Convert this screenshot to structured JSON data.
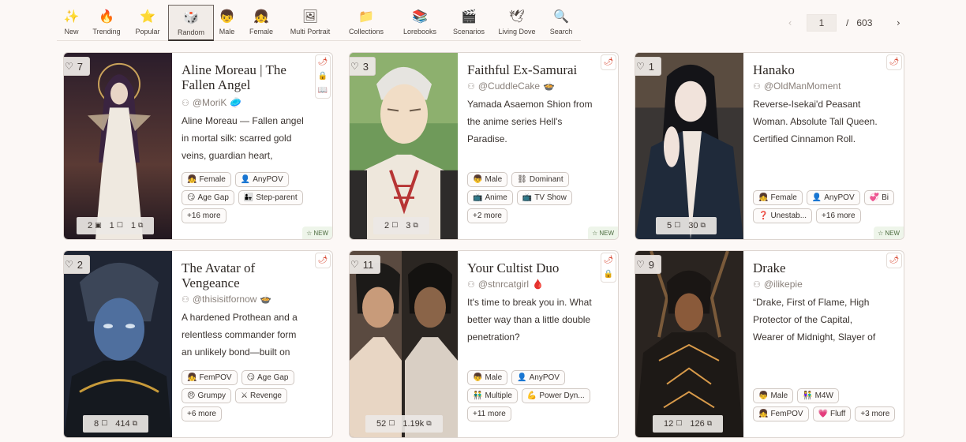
{
  "nav": {
    "items": [
      {
        "label": "New",
        "icon": "✨"
      },
      {
        "label": "Trending",
        "icon": "🔥"
      },
      {
        "label": "Popular",
        "icon": "⭐"
      },
      {
        "label": "Random",
        "icon": "🎲"
      },
      {
        "label": "Male",
        "icon": "👦"
      },
      {
        "label": "Female",
        "icon": "👧"
      },
      {
        "label": "Multi Portrait",
        "icon": "🖼"
      },
      {
        "label": "Collections",
        "icon": "📁"
      },
      {
        "label": "Lorebooks",
        "icon": "📚"
      },
      {
        "label": "Scenarios",
        "icon": "🎬"
      },
      {
        "label": "Living Dove",
        "icon": "🕊"
      },
      {
        "label": "Search",
        "icon": "🔍"
      }
    ],
    "active": "Random"
  },
  "pager": {
    "current": "1",
    "separator": "/",
    "total": "603",
    "prev": "‹",
    "next": "›"
  },
  "cards": [
    {
      "likes": "7",
      "title": "Aline Moreau | The Fallen Angel Adoptive...",
      "author": "@MoriK",
      "author_badge": "🥏",
      "desc": "Aline Moreau — Fallen angel in mortal silk: scarred gold veins, guardian heart, apocalypse-...",
      "tags": [
        {
          "icon": "👧",
          "label": "Female"
        },
        {
          "icon": "👤",
          "label": "AnyPOV"
        },
        {
          "icon": "😏",
          "label": "Age Gap"
        },
        {
          "icon": "👨‍👧",
          "label": "Step-parent"
        },
        {
          "icon": "",
          "label": "+16 more"
        }
      ],
      "stats": [
        "2",
        "1",
        "1"
      ],
      "side": [
        "🌶",
        "🔒",
        "📖"
      ],
      "new": "NEW",
      "image_colors": [
        "#3b2a3a",
        "#c9b79a",
        "#f2ede4"
      ]
    },
    {
      "likes": "3",
      "title": "Faithful Ex-Samurai",
      "author": "@CuddleCake",
      "author_badge": "🍲",
      "desc": "Yamada Asaemon Shion from the anime series Hell's Paradise.",
      "tags": [
        {
          "icon": "👦",
          "label": "Male"
        },
        {
          "icon": "⛓",
          "label": "Dominant"
        },
        {
          "icon": "📺",
          "label": "Anime"
        },
        {
          "icon": "📺",
          "label": "TV Show"
        },
        {
          "icon": "",
          "label": "+2 more"
        }
      ],
      "stats": [
        "2",
        "3"
      ],
      "side": [
        "🌶"
      ],
      "new": "NEW",
      "image_colors": [
        "#6f9a5a",
        "#e8e1d6",
        "#b73535"
      ]
    },
    {
      "likes": "1",
      "title": "Hanako",
      "author": "@OldManMoment",
      "author_badge": "",
      "desc": "Reverse-Isekai'd Peasant Woman. Absolute Tall Queen. Certified Cinnamon Roll.",
      "tags": [
        {
          "icon": "👧",
          "label": "Female"
        },
        {
          "icon": "👤",
          "label": "AnyPOV"
        },
        {
          "icon": "💞",
          "label": "Bi"
        },
        {
          "icon": "❓",
          "label": "Unestab..."
        },
        {
          "icon": "",
          "label": "+16 more"
        }
      ],
      "stats": [
        "5",
        "30"
      ],
      "side": [
        "🌶"
      ],
      "new": "NEW",
      "image_colors": [
        "#1d232d",
        "#efe6de",
        "#4a3a3a"
      ]
    },
    {
      "likes": "2",
      "title": "The Avatar of Vengeance",
      "author": "@thisisitfornow",
      "author_badge": "🍲",
      "desc": "A hardened Prothean and a relentless commander form an unlikely bond—built on shared...",
      "tags": [
        {
          "icon": "👧",
          "label": "FemPOV"
        },
        {
          "icon": "😏",
          "label": "Age Gap"
        },
        {
          "icon": "😠",
          "label": "Grumpy"
        },
        {
          "icon": "⚔",
          "label": "Revenge"
        },
        {
          "icon": "",
          "label": "+6 more"
        }
      ],
      "stats": [
        "8",
        "414"
      ],
      "side": [
        "🌶"
      ],
      "new": "",
      "image_colors": [
        "#2d3950",
        "#5d7ba6",
        "#1a1f2b"
      ]
    },
    {
      "likes": "11",
      "title": "Your Cultist Duo",
      "author": "@stnrcatgirl",
      "author_badge": "🩸",
      "desc": "It's time to break you in. What better way than a little double penetration?",
      "tags": [
        {
          "icon": "👦",
          "label": "Male"
        },
        {
          "icon": "👤",
          "label": "AnyPOV"
        },
        {
          "icon": "👬",
          "label": "Multiple"
        },
        {
          "icon": "💪",
          "label": "Power Dyn..."
        },
        {
          "icon": "",
          "label": "+11 more"
        }
      ],
      "stats": [
        "52",
        "1.19k"
      ],
      "side": [
        "🌶",
        "🔒"
      ],
      "new": "",
      "image_colors": [
        "#5a4a40",
        "#c89b7a",
        "#2b2622"
      ]
    },
    {
      "likes": "9",
      "title": "Drake",
      "author": "@ilikepie",
      "author_badge": "",
      "desc": "“Drake, First of Flame, High Protector of the Capital, Wearer of Midnight, Slayer of Oaths, ...",
      "tags": [
        {
          "icon": "👦",
          "label": "Male"
        },
        {
          "icon": "👫",
          "label": "M4W"
        },
        {
          "icon": "👧",
          "label": "FemPOV"
        },
        {
          "icon": "💗",
          "label": "Fluff"
        },
        {
          "icon": "",
          "label": "+3 more"
        }
      ],
      "stats": [
        "12",
        "126"
      ],
      "side": [
        "🌶"
      ],
      "new": "",
      "image_colors": [
        "#2a2420",
        "#7a5a3a",
        "#d89a4a"
      ]
    }
  ]
}
